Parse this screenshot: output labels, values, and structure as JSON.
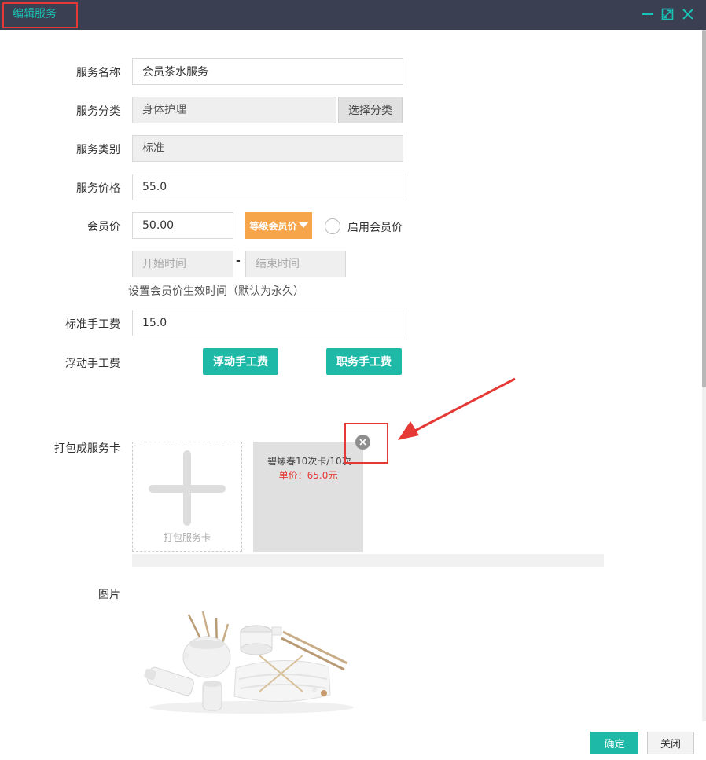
{
  "window": {
    "title": "编辑服务"
  },
  "form": {
    "name_label": "服务名称",
    "name_value": "会员茶水服务",
    "category_label": "服务分类",
    "category_value": "身体护理",
    "choose_category_button": "选择分类",
    "type_label": "服务类别",
    "type_value": "标准",
    "price_label": "服务价格",
    "price_value": "55.0",
    "member_price_label": "会员价",
    "member_price_value": "50.00",
    "level_price_button": "等级会员价",
    "enable_member_price_label": "启用会员价",
    "start_time_placeholder": "开始时间",
    "end_time_placeholder": "结束时间",
    "time_separator": "-",
    "time_hint": "设置会员价生效时间（默认为永久）",
    "std_fee_label": "标准手工费",
    "std_fee_value": "15.0",
    "float_fee_label": "浮动手工费",
    "float_fee_button": "浮动手工费",
    "position_fee_button": "职务手工费",
    "package_label": "打包成服务卡",
    "add_card_label": "打包服务卡",
    "service_cards": [
      {
        "name": "碧螺春10次卡/10次",
        "price_text": "单价：65.0元"
      }
    ],
    "image_label": "图片"
  },
  "footer": {
    "ok_button": "确定",
    "close_button": "关闭"
  },
  "colors": {
    "accent": "#1fbaa7",
    "titlebar": "#3a3f51",
    "annotation": "#e53935",
    "orange": "#f7a54a"
  },
  "icons": [
    "minimize-icon",
    "maximize-icon",
    "close-icon",
    "remove-card-icon",
    "plus-icon",
    "caret-down-icon"
  ]
}
